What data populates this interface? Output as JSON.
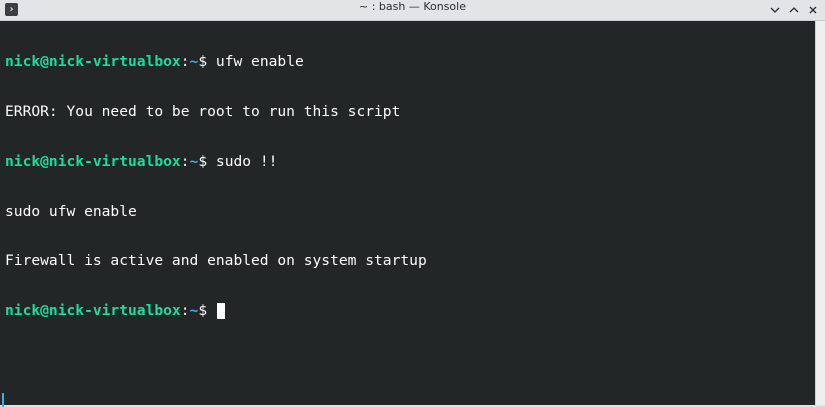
{
  "window": {
    "title": "~ : bash — Konsole",
    "app_icon": "terminal-icon",
    "controls": [
      "chevron-down-icon",
      "chevron-up-icon",
      "close-icon"
    ]
  },
  "terminal": {
    "prompt_user_host": "nick@nick-virtualbox",
    "prompt_colon": ":",
    "prompt_path": "~",
    "prompt_symbol": "$ ",
    "lines": [
      {
        "type": "prompt",
        "command": "ufw enable"
      },
      {
        "type": "output",
        "text": "ERROR: You need to be root to run this script"
      },
      {
        "type": "prompt",
        "command": "sudo !!"
      },
      {
        "type": "output",
        "text": "sudo ufw enable"
      },
      {
        "type": "output",
        "text": "Firewall is active and enabled on system startup"
      },
      {
        "type": "prompt",
        "command": ""
      }
    ]
  },
  "colors": {
    "background": "#232627",
    "foreground": "#fcfcfc",
    "user_host": "#1cdc9a",
    "path": "#3daee9"
  }
}
